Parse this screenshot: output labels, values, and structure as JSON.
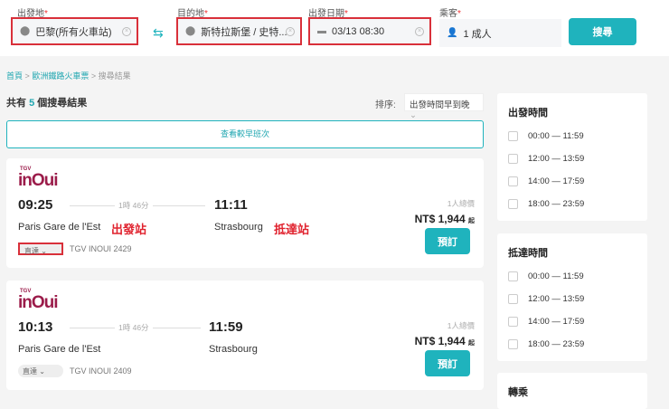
{
  "search": {
    "from_label": "出發地",
    "from_value": "巴黎(所有火車站)",
    "to_label": "目的地",
    "to_value": "斯特拉斯堡 / 史特...",
    "date_label": "出發日期",
    "date_value": "03/13 08:30",
    "pax_label": "乘客",
    "pax_value": "1 成人",
    "search_button": "搜尋",
    "required_mark": "*"
  },
  "breadcrumb": [
    "首頁",
    "歐洲鐵路火車票",
    "搜尋結果"
  ],
  "breadcrumb_sep": ">",
  "results": {
    "prefix": "共有",
    "count": "5",
    "suffix": "個搜尋結果",
    "sort_label": "排序:",
    "sort_value": "出發時間早到晚",
    "earlier_button": "查看較早班次"
  },
  "trains": [
    {
      "logo_top": "TGV",
      "logo": "inOui",
      "depart": "09:25",
      "duration": "1時 46分",
      "arrive": "11:11",
      "from": "Paris Gare de l'Est",
      "to": "Strasbourg",
      "from_note": "出發站",
      "to_note": "抵達站",
      "tag": "直達",
      "train": "TGV INOUI 2429",
      "price_label": "1人總價",
      "price": "NT$ 1,944",
      "price_suffix": "起",
      "book": "預訂"
    },
    {
      "logo_top": "TGV",
      "logo": "inOui",
      "depart": "10:13",
      "duration": "1時 46分",
      "arrive": "11:59",
      "from": "Paris Gare de l'Est",
      "to": "Strasbourg",
      "tag": "直達",
      "train": "TGV INOUI 2409",
      "price_label": "1人總價",
      "price": "NT$ 1,944",
      "price_suffix": "起",
      "book": "預訂"
    }
  ],
  "filters": [
    {
      "title": "出發時間",
      "options": [
        "00:00 — 11:59",
        "12:00 — 13:59",
        "14:00 — 17:59",
        "18:00 — 23:59"
      ]
    },
    {
      "title": "抵達時間",
      "options": [
        "00:00 — 11:59",
        "12:00 — 13:59",
        "14:00 — 17:59",
        "18:00 — 23:59"
      ]
    },
    {
      "title": "轉乘"
    }
  ],
  "colors": {
    "accent": "#1fb3bd",
    "highlight": "#d9303a",
    "brand": "#9b1c4a"
  }
}
